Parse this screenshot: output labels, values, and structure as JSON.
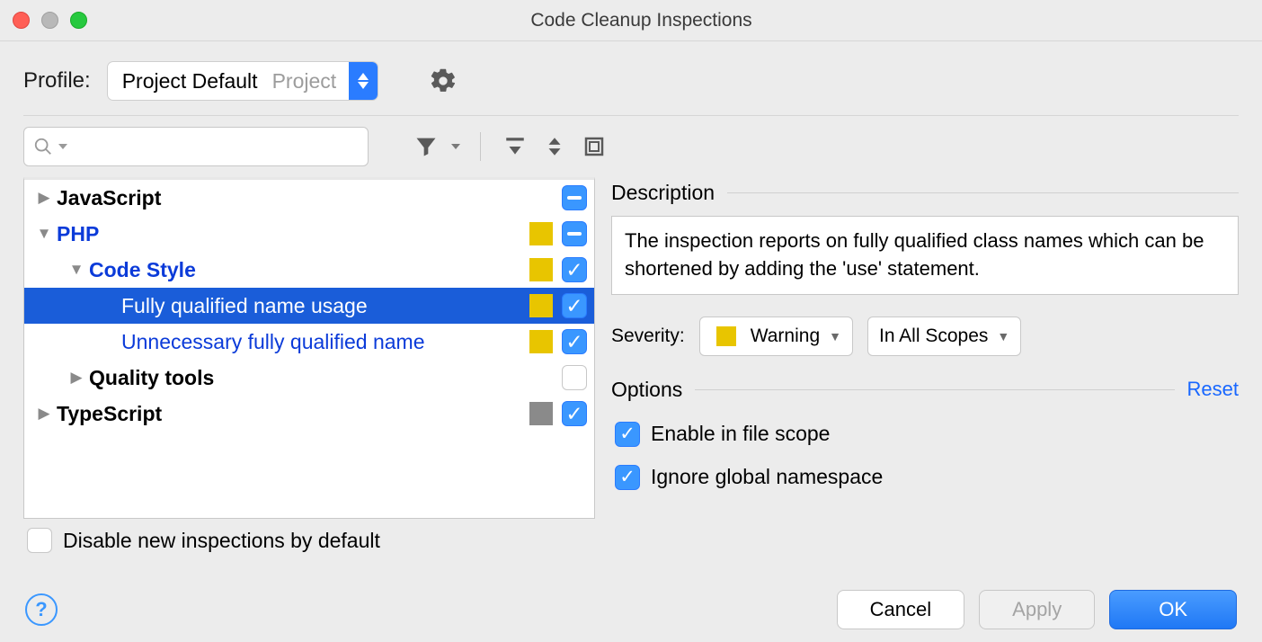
{
  "window_title": "Code Cleanup Inspections",
  "profile_label": "Profile:",
  "profile_value": "Project Default",
  "profile_scope": "Project",
  "tree": {
    "javascript": "JavaScript",
    "php": "PHP",
    "code_style": "Code Style",
    "fqn_usage": "Fully qualified name usage",
    "unnecessary_fqn": "Unnecessary fully qualified name",
    "quality_tools": "Quality tools",
    "typescript": "TypeScript"
  },
  "disable_new_label": "Disable new inspections by default",
  "description_label": "Description",
  "description_text": "The inspection reports on fully qualified class names which can be shortened by adding the 'use' statement.",
  "severity_label": "Severity:",
  "severity_value": "Warning",
  "scope_value": "In All Scopes",
  "options_label": "Options",
  "reset_label": "Reset",
  "opt_file_scope": "Enable in file scope",
  "opt_ignore_ns": "Ignore global namespace",
  "cancel": "Cancel",
  "apply": "Apply",
  "ok": "OK"
}
